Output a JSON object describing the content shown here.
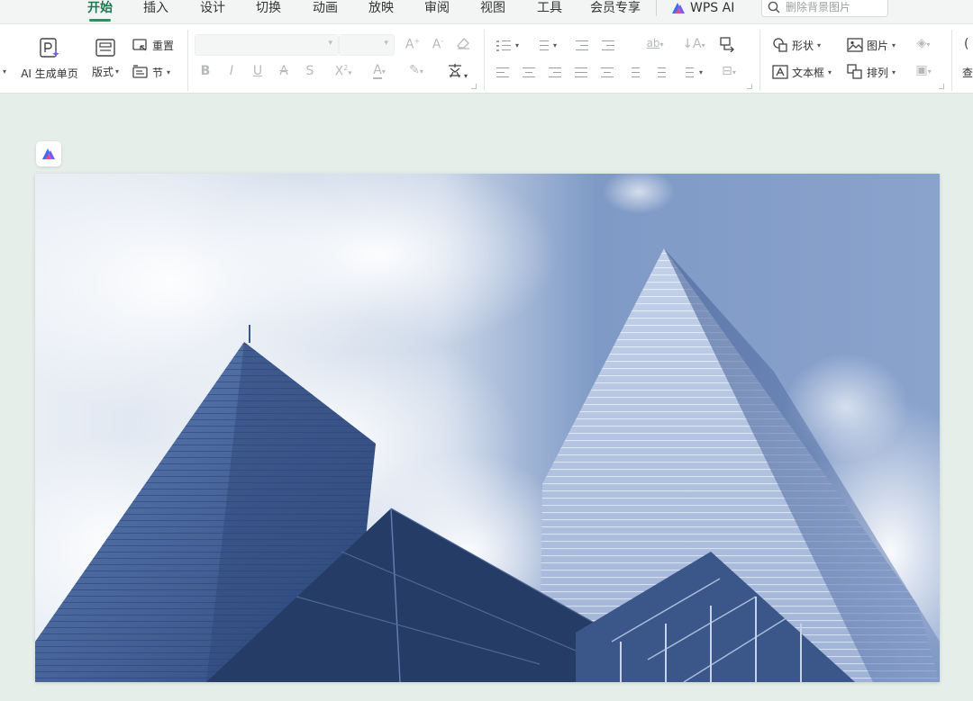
{
  "tabs": [
    {
      "label": "开始",
      "active": true
    },
    {
      "label": "插入"
    },
    {
      "label": "设计"
    },
    {
      "label": "切换"
    },
    {
      "label": "动画"
    },
    {
      "label": "放映"
    },
    {
      "label": "审阅"
    },
    {
      "label": "视图"
    },
    {
      "label": "工具"
    },
    {
      "label": "会员专享"
    }
  ],
  "wps_ai_label": "WPS AI",
  "search": {
    "placeholder": "删除背景图片",
    "icon": "search-icon"
  },
  "ribbon": {
    "ai_slide_label": "AI 生成单页",
    "layout_label": "版式",
    "reset_label": "重置",
    "section_label": "节",
    "shape_label": "形状",
    "picture_label": "图片",
    "textbox_label": "文本框",
    "arrange_label": "排列",
    "find_label": "查"
  },
  "colors": {
    "accent": "#1c9a63",
    "ai_purple": "#7a5cf0",
    "ai_blue": "#3d6cf5"
  },
  "slide": {
    "content": "photo of two glass skyscrapers against a cloudy blue sky, blue-tinted"
  }
}
